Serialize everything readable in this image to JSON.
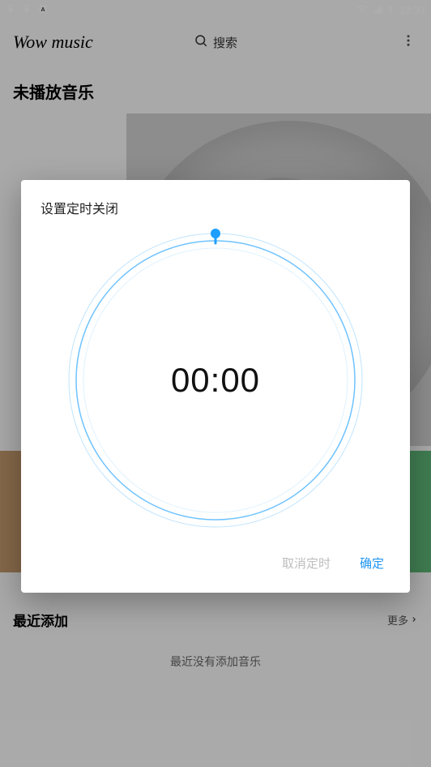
{
  "status": {
    "time": "12:37"
  },
  "appbar": {
    "title": "Wow music",
    "search_label": "搜索"
  },
  "main": {
    "now_playing_title": "未播放音乐",
    "recent_title": "最近添加",
    "more_label": "更多",
    "empty_text": "最近没有添加音乐"
  },
  "dialog": {
    "title": "设置定时关闭",
    "time_value": "00:00",
    "cancel_label": "取消定时",
    "ok_label": "确定"
  }
}
